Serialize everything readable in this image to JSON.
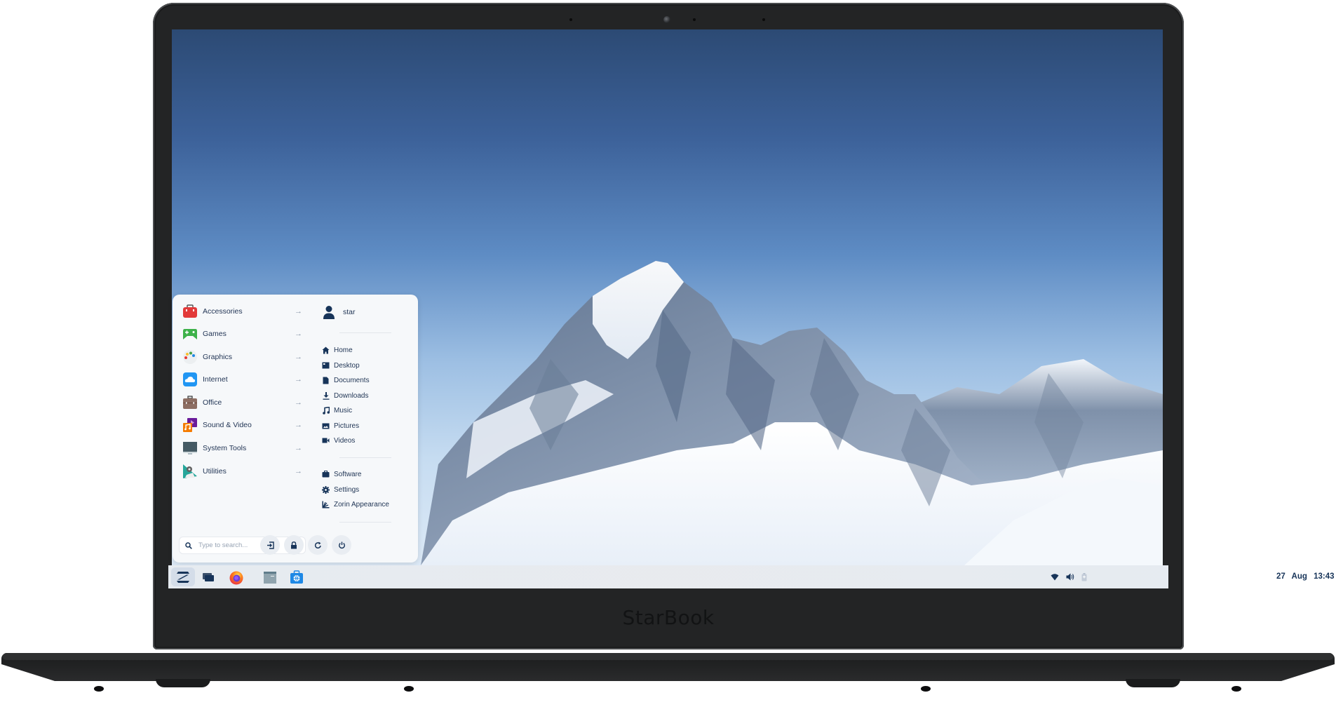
{
  "device": {
    "brand": "StarBook"
  },
  "start_menu": {
    "categories": [
      {
        "label": "Accessories",
        "icon": "toolbox-icon",
        "color": "#e23a3a"
      },
      {
        "label": "Games",
        "icon": "gamepad-icon",
        "color": "#3db14a"
      },
      {
        "label": "Graphics",
        "icon": "palette-icon",
        "color": "#eeeeee"
      },
      {
        "label": "Internet",
        "icon": "cloud-icon",
        "color": "#2196f3"
      },
      {
        "label": "Office",
        "icon": "briefcase-icon",
        "color": "#8d6e63"
      },
      {
        "label": "Sound & Video",
        "icon": "media-icon",
        "color": "#f57c00"
      },
      {
        "label": "System Tools",
        "icon": "monitor-icon",
        "color": "#455a64"
      },
      {
        "label": "Utilities",
        "icon": "utilities-icon",
        "color": "#26a69a"
      }
    ],
    "user": {
      "name": "star",
      "icon": "user-icon"
    },
    "places": [
      {
        "label": "Home",
        "icon": "home-icon"
      },
      {
        "label": "Desktop",
        "icon": "desktop-icon"
      },
      {
        "label": "Documents",
        "icon": "document-icon"
      },
      {
        "label": "Downloads",
        "icon": "download-icon"
      },
      {
        "label": "Music",
        "icon": "music-icon"
      },
      {
        "label": "Pictures",
        "icon": "picture-icon"
      },
      {
        "label": "Videos",
        "icon": "video-icon"
      }
    ],
    "system": [
      {
        "label": "Software",
        "icon": "software-icon"
      },
      {
        "label": "Settings",
        "icon": "gear-icon"
      },
      {
        "label": "Zorin Appearance",
        "icon": "appearance-icon"
      }
    ],
    "search": {
      "placeholder": "Type to search..."
    },
    "power_buttons": [
      {
        "name": "logout",
        "icon": "logout-icon"
      },
      {
        "name": "lock",
        "icon": "lock-icon"
      },
      {
        "name": "restart",
        "icon": "restart-icon"
      },
      {
        "name": "power-off",
        "icon": "power-icon"
      }
    ],
    "accent_color": "#173459"
  },
  "taskbar": {
    "apps": [
      {
        "name": "zorin-menu",
        "icon": "zorin-logo-icon",
        "active": true
      },
      {
        "name": "workspaces",
        "icon": "windows-icon"
      },
      {
        "name": "firefox",
        "icon": "firefox-icon"
      },
      {
        "name": "files",
        "icon": "folder-icon"
      },
      {
        "name": "software-store",
        "icon": "store-icon"
      }
    ],
    "tray": [
      "wifi-icon",
      "volume-icon",
      "battery-icon"
    ],
    "clock": {
      "date": "27 Aug",
      "time": "13:43"
    }
  }
}
